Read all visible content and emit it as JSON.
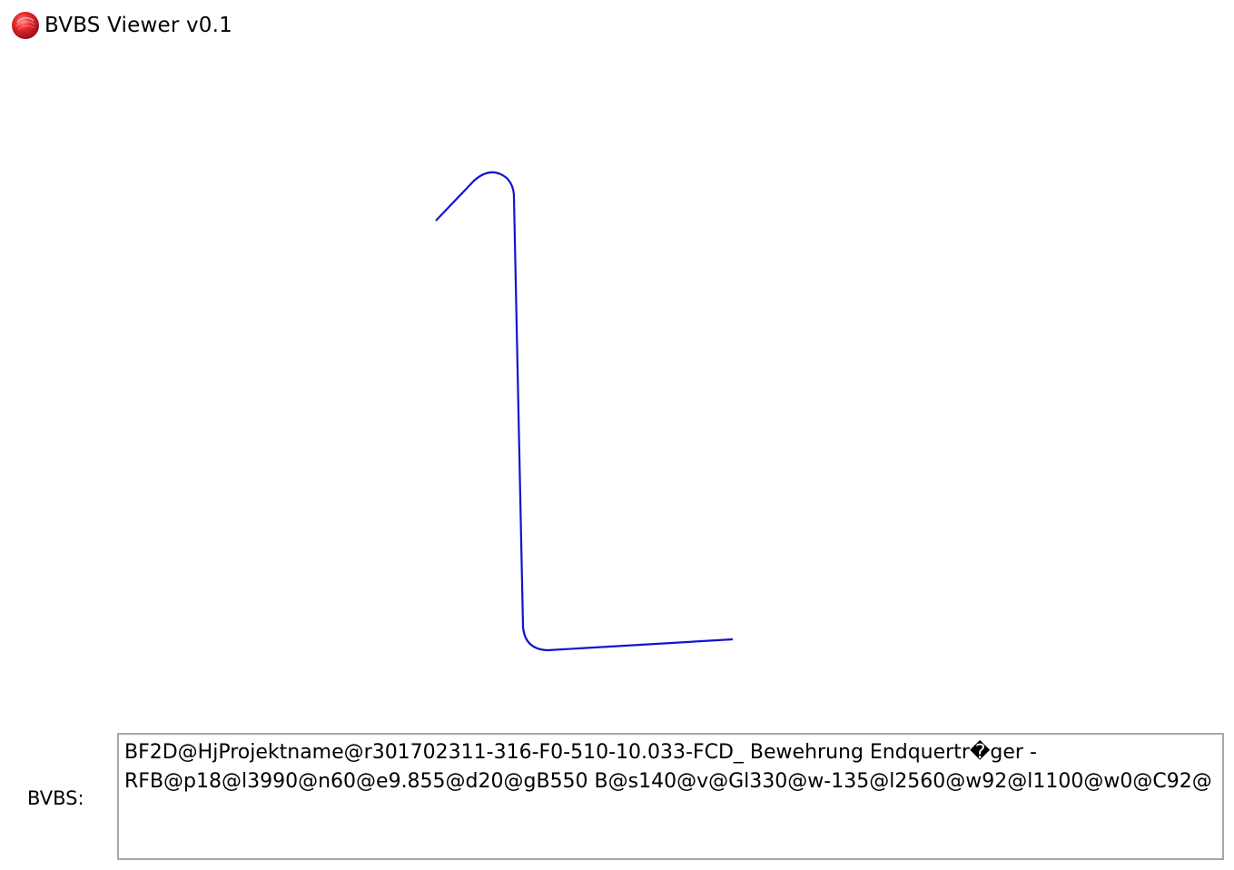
{
  "window": {
    "title": "BVBS Viewer v0.1",
    "icon": "red-sphere-icon"
  },
  "drawing": {
    "stroke_color": "#1414cc",
    "description_shape": "bent-bar"
  },
  "bvbs": {
    "label": "BVBS:",
    "value": "BF2D@HjProjektname@r301702311-316-F0-510-10.033-FCD_ Bewehrung Endquertr�ger -\nRFB@p18@l3990@n60@e9.855@d20@gB550 B@s140@v@Gl330@w-135@l2560@w92@l1100@w0@C92@"
  },
  "colors": {
    "icon_red": "#e0262b",
    "box_border": "#a8a8a8"
  }
}
